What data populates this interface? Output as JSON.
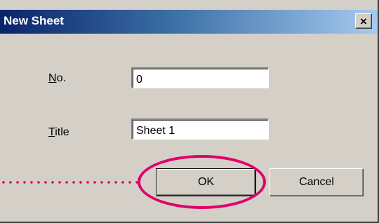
{
  "window": {
    "title": "New Sheet",
    "close_glyph": "×"
  },
  "fields": {
    "no": {
      "label_mnemonic": "N",
      "label_rest": "o.",
      "value": "0"
    },
    "title": {
      "label_mnemonic": "T",
      "label_rest": "itle",
      "value": "Sheet 1"
    }
  },
  "buttons": {
    "ok_label": "OK",
    "cancel_label": "Cancel"
  },
  "annotation": {
    "color": "#e0006a",
    "highlighted": "OK"
  },
  "colors": {
    "dialog_bg": "#d4d0c8",
    "titlebar_start": "#0a246a",
    "titlebar_end": "#a6caf0"
  }
}
